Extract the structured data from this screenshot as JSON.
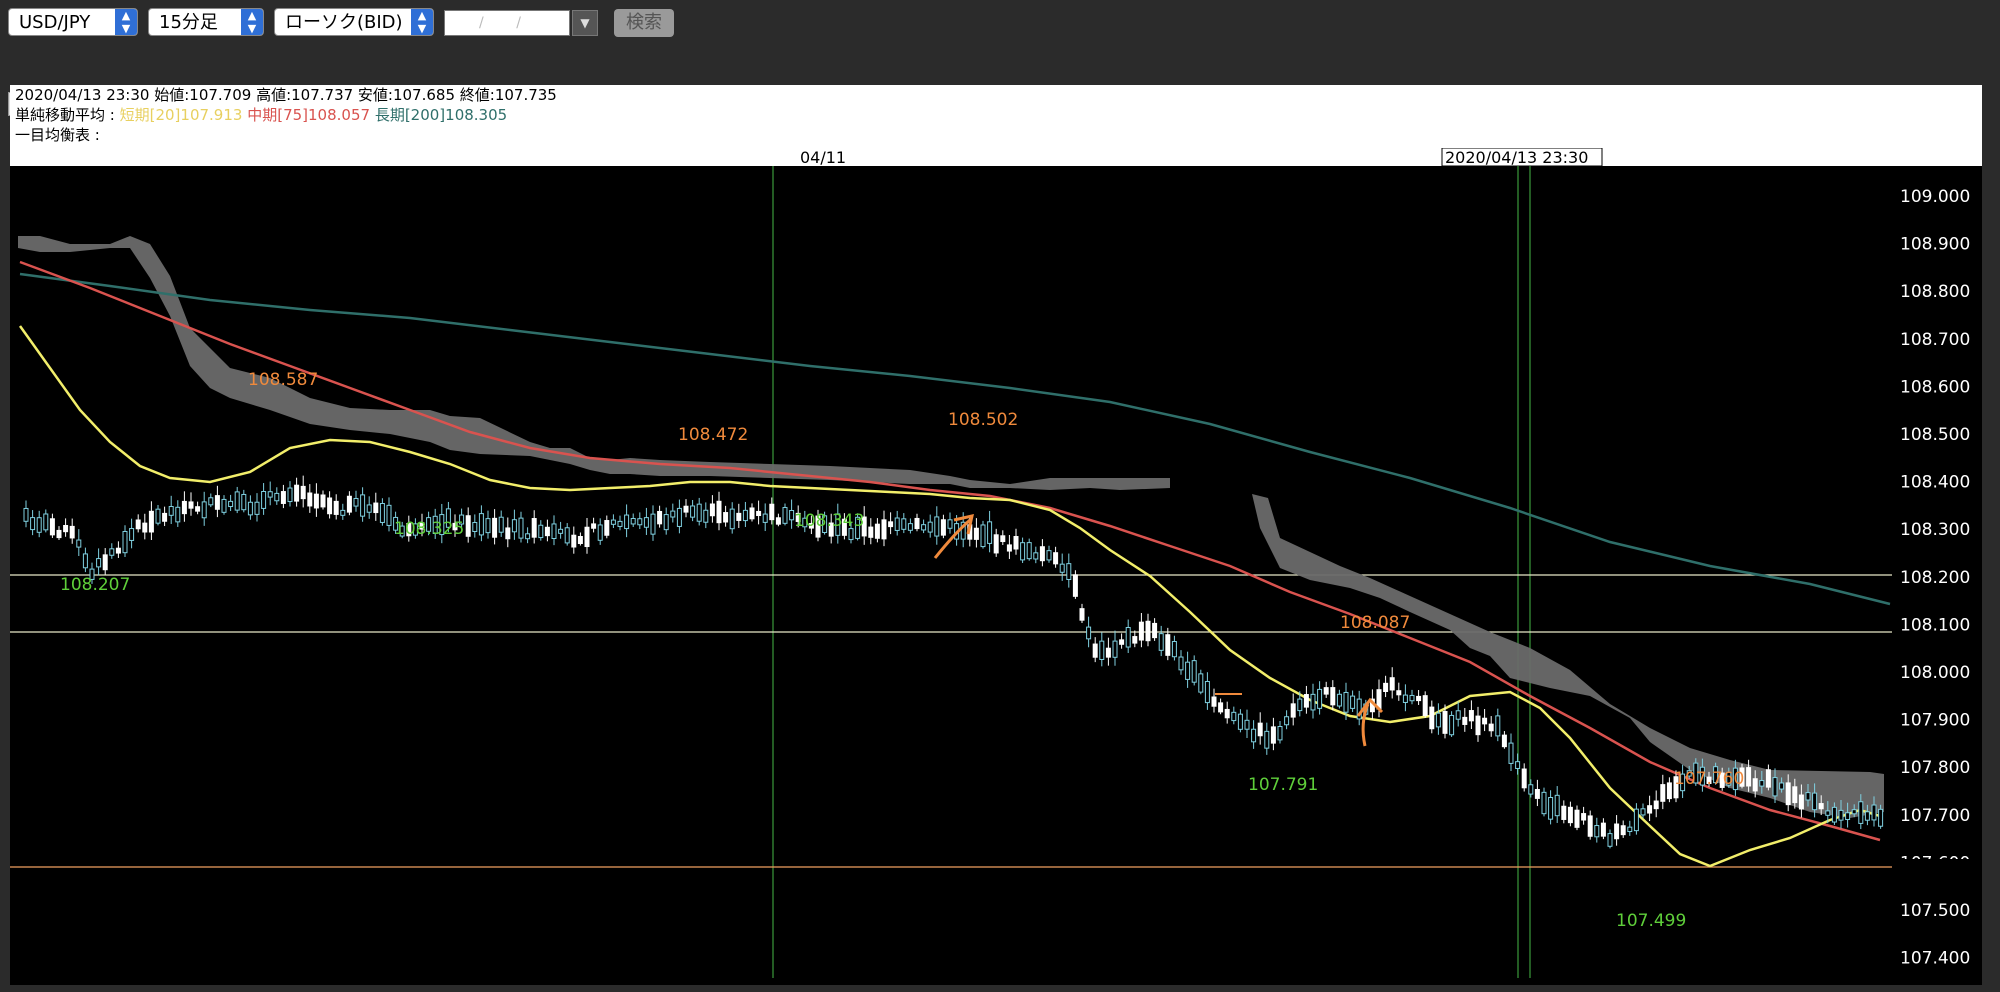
{
  "toolbar": {
    "pair": "USD/JPY",
    "timeframe": "15分足",
    "chart_type": "ローソク(BID)",
    "date_placeholder": "/ /",
    "search_label": "検索",
    "line_width": "1",
    "line_style": "通常線"
  },
  "info": {
    "ohlc_line": "2020/04/13 23:30 始値:107.709 高値:107.737 安値:107.685 終値:107.735",
    "sma_label": "単純移動平均 :",
    "sma_short": "短期[20]107.913",
    "sma_mid": "中期[75]108.057",
    "sma_long": "長期[200]108.305",
    "ichimoku_label": "一目均衡表 :"
  },
  "chart": {
    "date_marker": "04/11",
    "cursor_time": "2020/04/13 23:30",
    "y_labels": [
      "109.000",
      "108.900",
      "108.800",
      "108.700",
      "108.600",
      "108.500",
      "108.400",
      "108.300",
      "108.200",
      "108.100",
      "108.000",
      "107.900",
      "107.800",
      "107.700",
      "107.600",
      "107.500",
      "107.400"
    ],
    "current_price": "107.600",
    "annotations_high": [
      "108.587",
      "108.472",
      "108.502",
      "108.087",
      "107.760"
    ],
    "annotations_low": [
      "108.207",
      "108.325",
      "108.343",
      "107.791",
      "107.499"
    ]
  },
  "colors": {
    "sma_short": "#f2ee6a",
    "sma_mid": "#d9534f",
    "sma_long": "#2f6f6a",
    "cloud": "#6a6a6a",
    "high_label": "#f08a3c",
    "low_label": "#5fcf3a",
    "hline": "#e8e8c8",
    "current_line": "#f0a060"
  }
}
